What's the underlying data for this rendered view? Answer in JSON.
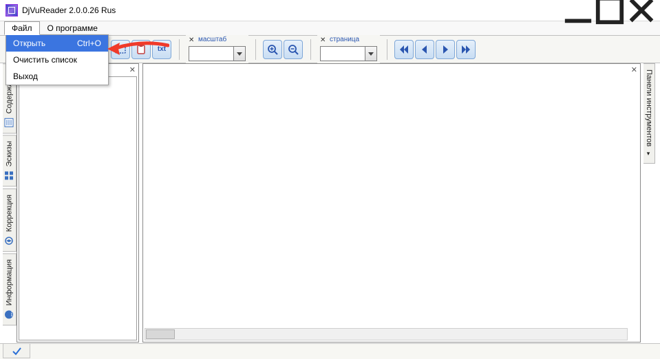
{
  "window": {
    "title": "DjVuReader 2.0.0.26 Rus"
  },
  "menubar": {
    "file_label": "Файл",
    "about_label": "О программе"
  },
  "file_menu": {
    "open_label": "Открыть",
    "open_shortcut": "Ctrl+O",
    "clear_label": "Очистить список",
    "exit_label": "Выход"
  },
  "toolbar": {
    "zoom_group_label": "масштаб",
    "page_group_label": "страница",
    "zoom_value": "",
    "page_value": ""
  },
  "left_tabs": {
    "contents": "Содержание",
    "thumbs": "Эскизы",
    "correction": "Коррекция",
    "info": "Информация"
  },
  "right_tabs": {
    "tools_panel": "Панели инструментов"
  },
  "icons": {
    "select_rect": "select-rect",
    "clipboard": "clipboard",
    "txt": "txt",
    "zoom_in": "zoom-in",
    "zoom_out": "zoom-out",
    "nav_first": "first",
    "nav_prev": "prev",
    "nav_next": "next",
    "nav_last": "last",
    "check": "check"
  },
  "colors": {
    "btn_border": "#7fa7d7",
    "menu_highlight": "#3b75e0",
    "arrow": "#f03a2a"
  }
}
